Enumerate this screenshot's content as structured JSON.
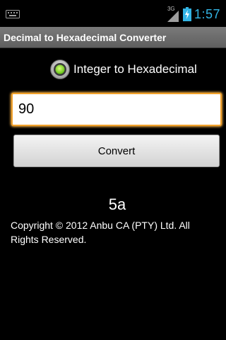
{
  "status_bar": {
    "network_label": "3G",
    "time": "1:57",
    "icons": [
      "keyboard-icon",
      "signal-icon",
      "battery-charging-icon"
    ],
    "clock_color": "#33b5e5"
  },
  "title_bar": {
    "title": "Decimal to Hexadecimal Converter"
  },
  "conversion_option": {
    "label": "Integer to Hexadecimal",
    "selected": true
  },
  "input": {
    "value": "90",
    "focus_color": "#f2a12a"
  },
  "convert_button": {
    "label": "Convert"
  },
  "result": {
    "value": "5a"
  },
  "footer": {
    "copyright": "Copyright © 2012 Anbu CA (PTY) Ltd. All Rights Reserved."
  }
}
